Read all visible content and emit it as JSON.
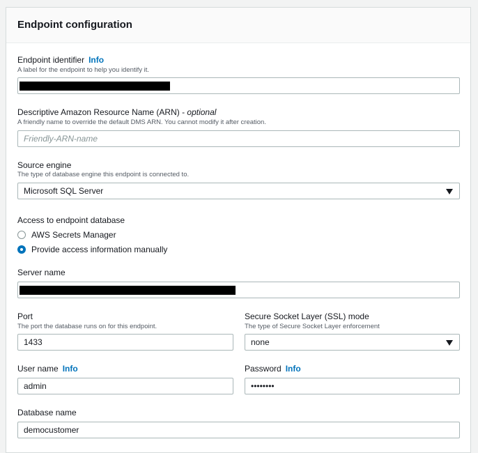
{
  "panel": {
    "title": "Endpoint configuration"
  },
  "endpoint_identifier": {
    "label": "Endpoint identifier",
    "info": "Info",
    "description": "A label for the endpoint to help you identify it."
  },
  "arn": {
    "label": "Descriptive Amazon Resource Name (ARN) - ",
    "optional": "optional",
    "description": "A friendly name to override the default DMS ARN. You cannot modify it after creation.",
    "placeholder": "Friendly-ARN-name"
  },
  "source_engine": {
    "label": "Source engine",
    "description": "The type of database engine this endpoint is connected to.",
    "value": "Microsoft SQL Server"
  },
  "access": {
    "label": "Access to endpoint database",
    "options": [
      {
        "label": "AWS Secrets Manager",
        "selected": false
      },
      {
        "label": "Provide access information manually",
        "selected": true
      }
    ]
  },
  "server_name": {
    "label": "Server name"
  },
  "port": {
    "label": "Port",
    "description": "The port the database runs on for this endpoint.",
    "value": "1433"
  },
  "ssl": {
    "label": "Secure Socket Layer (SSL) mode",
    "description": "The type of Secure Socket Layer enforcement",
    "value": "none"
  },
  "user_name": {
    "label": "User name",
    "info": "Info",
    "value": "admin"
  },
  "password": {
    "label": "Password",
    "info": "Info",
    "value": "••••••••"
  },
  "database_name": {
    "label": "Database name",
    "value": "democustomer"
  }
}
